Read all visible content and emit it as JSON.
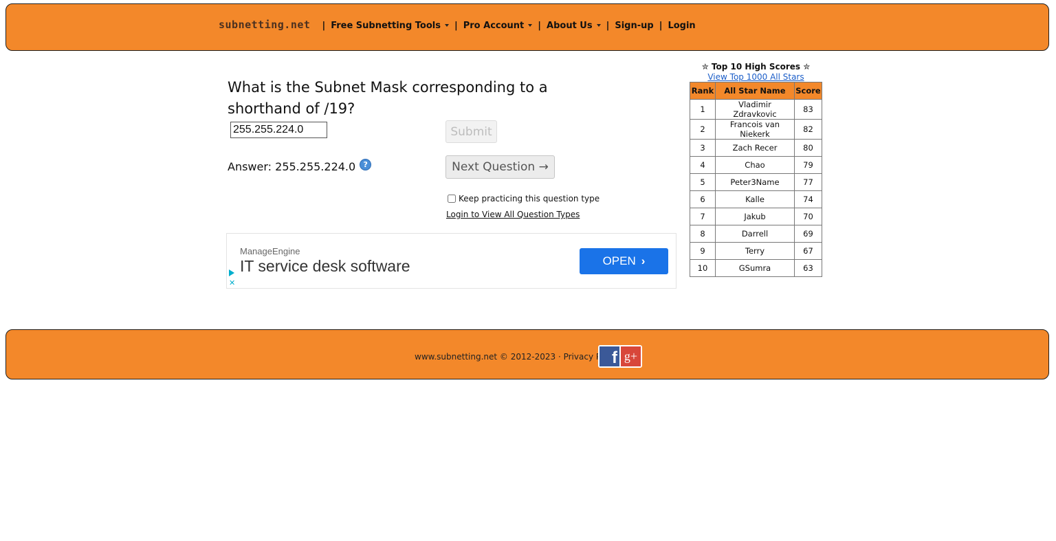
{
  "header": {
    "logo": "subnetting.net",
    "separator": "|",
    "nav": [
      {
        "label": "Free Subnetting Tools",
        "dropdown": true
      },
      {
        "label": "Pro Account",
        "dropdown": true
      },
      {
        "label": "About Us",
        "dropdown": true
      },
      {
        "label": "Sign-up",
        "dropdown": false
      },
      {
        "label": "Login",
        "dropdown": false
      }
    ]
  },
  "quiz": {
    "question": "What is the Subnet Mask corresponding to a shorthand of /19?",
    "input_value": "255.255.224.0",
    "submit_label": "Submit",
    "answer_prefix": "Answer:",
    "answer_value": "255.255.224.0",
    "help_icon": "?",
    "next_label": "Next Question →",
    "keep_practicing_label": "Keep practicing this question type",
    "login_link": "Login to View All Question Types"
  },
  "ad": {
    "brand": "ManageEngine",
    "title": "IT service desk software",
    "cta": "OPEN",
    "close": "✕"
  },
  "highscores": {
    "title": "✮ Top 10 High Scores ✮",
    "link": "View Top 1000 All Stars",
    "headers": [
      "Rank",
      "All Star Name",
      "Score"
    ],
    "rows": [
      {
        "rank": "1",
        "name": "Vladimir Zdravkovic",
        "score": "83"
      },
      {
        "rank": "2",
        "name": "Francois van Niekerk",
        "score": "82"
      },
      {
        "rank": "3",
        "name": "Zach Recer",
        "score": "80"
      },
      {
        "rank": "4",
        "name": "Chao",
        "score": "79"
      },
      {
        "rank": "5",
        "name": "Peter3Name",
        "score": "77"
      },
      {
        "rank": "6",
        "name": "Kalle",
        "score": "74"
      },
      {
        "rank": "7",
        "name": "Jakub",
        "score": "70"
      },
      {
        "rank": "8",
        "name": "Darrell",
        "score": "69"
      },
      {
        "rank": "9",
        "name": "Terry",
        "score": "67"
      },
      {
        "rank": "10",
        "name": "GSumra",
        "score": "63"
      }
    ]
  },
  "footer": {
    "copyright": "www.subnetting.net © 2012-2023 ·",
    "privacy": "Privacy Policy",
    "social": [
      {
        "icon": "facebook-icon",
        "glyph": "f"
      },
      {
        "icon": "google-plus-icon",
        "glyph": "g+"
      }
    ]
  },
  "colors": {
    "brand_orange": "#f3882a",
    "ad_button": "#1a73e8",
    "link": "#1a5dc8"
  }
}
